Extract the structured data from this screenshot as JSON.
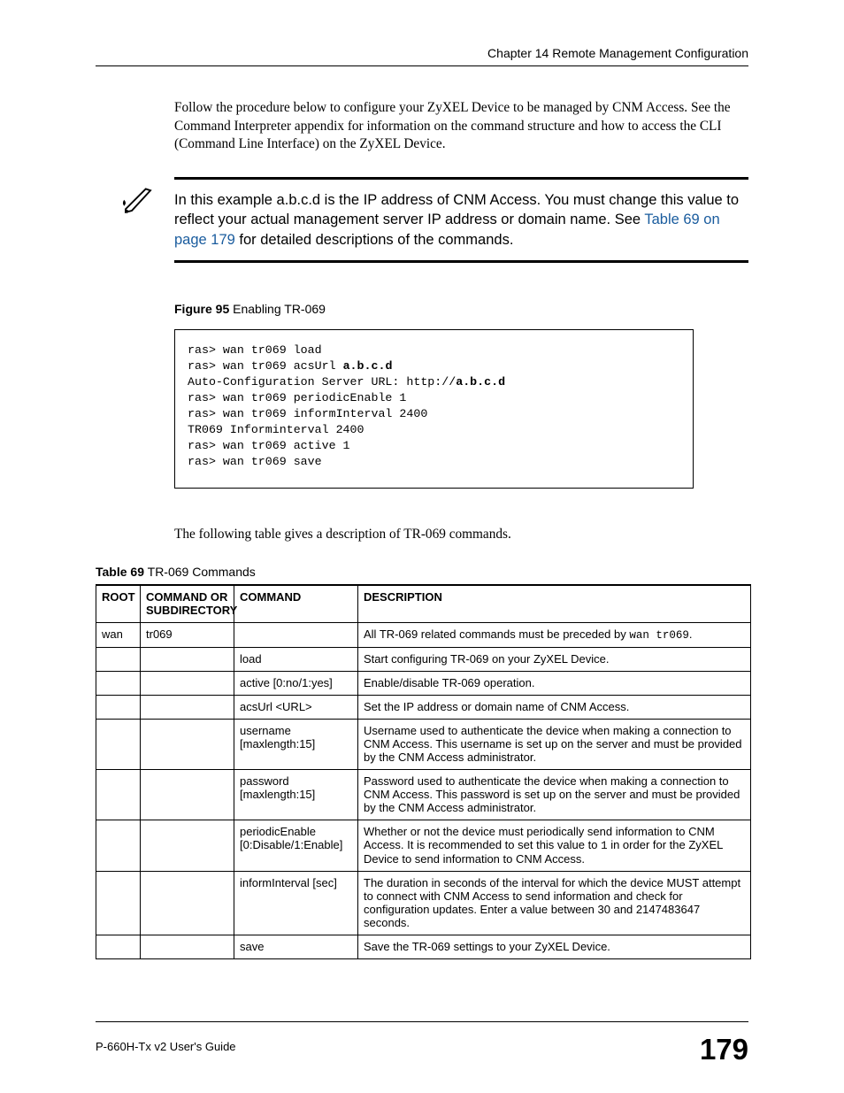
{
  "header": {
    "chapter": "Chapter 14 Remote Management Configuration"
  },
  "intro": "Follow the procedure below to configure your ZyXEL Device to be managed by CNM Access. See the Command Interpreter appendix for information on the command structure and how to access the CLI (Command Line Interface) on the ZyXEL Device.",
  "note": {
    "pre_xref": "In this example a.b.c.d is the IP address of CNM Access. You must change this value to reflect your actual management server IP address or domain name. See ",
    "xref": "Table 69 on page 179",
    "post_xref": " for detailed descriptions of the commands."
  },
  "figure": {
    "label": "Figure 95",
    "title": "   Enabling TR-069",
    "code_html": "ras> wan tr069 load\nras> wan tr069 acsUrl <span class=\"b\">a.b.c.d</span>\nAuto-Configuration Server URL: http://<span class=\"b\">a.b.c.d</span>\nras> wan tr069 periodicEnable 1\nras> wan tr069 informInterval 2400\nTR069 Informinterval 2400\nras> wan tr069 active 1\nras> wan tr069 save"
  },
  "after_code": "The following table gives a description of TR-069 commands.",
  "table": {
    "label": "Table 69",
    "title": "   TR-069 Commands",
    "headers": {
      "root": "ROOT",
      "sub": "COMMAND OR SUBDIRECTORY",
      "cmd": "COMMAND",
      "desc": "DESCRIPTION"
    },
    "rows": [
      {
        "root": "wan",
        "root_mono": true,
        "sub": "tr069",
        "sub_mono": true,
        "cmd": "",
        "desc_html": "All TR-069 related commands must be preceded by <span class=\"desc-inline-code\">wan tr069</span>."
      },
      {
        "root": "",
        "sub": "",
        "cmd": "load",
        "desc_html": "Start configuring TR-069 on your ZyXEL Device."
      },
      {
        "root": "",
        "sub": "",
        "cmd": "active [0:no/1:yes]",
        "desc_html": "Enable/disable TR-069 operation."
      },
      {
        "root": "",
        "sub": "",
        "cmd": "acsUrl <URL>",
        "desc_html": "Set the IP address or domain name of CNM Access."
      },
      {
        "root": "",
        "sub": "",
        "cmd": "username [maxlength:15]",
        "desc_html": "Username used to authenticate the device when making a connection to CNM Access. This username is set up on the server and must be provided by the CNM Access administrator."
      },
      {
        "root": "",
        "sub": "",
        "cmd": "password [maxlength:15]",
        "desc_html": "Password used to authenticate the device when making a connection to CNM Access. This password is set up on the server and must be provided by the CNM Access administrator."
      },
      {
        "root": "",
        "sub": "",
        "cmd": "periodicEnable [0:Disable/1:Enable]",
        "desc_html": "Whether or not the device must periodically send information to CNM Access. It is recommended to set this value to <span class=\"desc-inline-code\">1</span> in order for the ZyXEL Device to send information to CNM Access."
      },
      {
        "root": "",
        "sub": "",
        "cmd": "informInterval [sec]",
        "desc_html": "The duration in seconds of the interval for which the device MUST attempt to connect with CNM Access to send information and check for configuration updates. Enter a value between 30 and 2147483647 seconds."
      },
      {
        "root": "",
        "sub": "",
        "cmd": "save",
        "desc_html": "Save the TR-069 settings to your ZyXEL Device."
      }
    ]
  },
  "footer": {
    "guide": "P-660H-Tx v2 User's Guide",
    "page": "179"
  }
}
